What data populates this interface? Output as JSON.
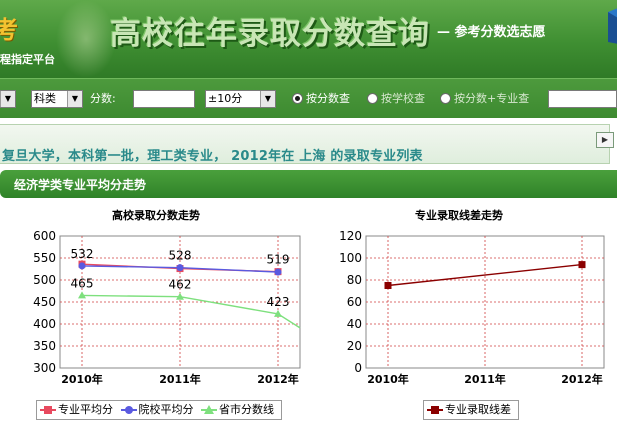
{
  "banner": {
    "logo_char": "考",
    "platform_text": "程指定平台",
    "title": "高校往年录取分数查询",
    "subtitle": "— 参考分数选志愿"
  },
  "toolbar": {
    "category_value": "科类",
    "score_label": "分数:",
    "score_value": "",
    "range_value": "±10分",
    "radio_options": [
      {
        "label": "按分数查",
        "selected": true
      },
      {
        "label": "按学校查",
        "selected": false
      },
      {
        "label": "按分数+专业查",
        "selected": false
      }
    ]
  },
  "breadcrumb": {
    "text": "复旦大学，本科第一批，理工类专业， 2012年在 上海 的录取专业列表"
  },
  "section": {
    "title": "经济学类专业平均分走势"
  },
  "colors": {
    "major_avg": "#e84a5f",
    "school_avg": "#5a5ae0",
    "province_line": "#7ee07e",
    "diff": "#8b0000",
    "grid": "#d04040"
  },
  "chart_data": [
    {
      "type": "line",
      "title": "高校录取分数走势",
      "x": [
        "2010年",
        "2011年",
        "2012年"
      ],
      "ylim": [
        300,
        600
      ],
      "yticks": [
        300,
        350,
        400,
        450,
        500,
        550,
        600
      ],
      "series": [
        {
          "name": "专业平均分",
          "values": [
            536,
            526,
            519
          ],
          "labels": [
            "",
            "",
            "519"
          ],
          "color_key": "major_avg",
          "marker": "square"
        },
        {
          "name": "院校平均分",
          "values": [
            532,
            528,
            518
          ],
          "labels": [
            "532",
            "528",
            ""
          ],
          "color_key": "school_avg",
          "marker": "circle"
        },
        {
          "name": "省市分数线",
          "values": [
            465,
            462,
            423
          ],
          "labels": [
            "465",
            "462",
            "423"
          ],
          "color_key": "province_line",
          "marker": "triangle"
        }
      ],
      "grid": true
    },
    {
      "type": "line",
      "title": "专业录取线差走势",
      "x": [
        "2010年",
        "2011年",
        "2012年"
      ],
      "ylim": [
        0,
        120
      ],
      "yticks": [
        0,
        20,
        40,
        60,
        80,
        100,
        120
      ],
      "series": [
        {
          "name": "专业录取线差",
          "values": [
            75,
            null,
            94
          ],
          "color_key": "diff",
          "marker": "square"
        }
      ],
      "grid": true
    }
  ]
}
